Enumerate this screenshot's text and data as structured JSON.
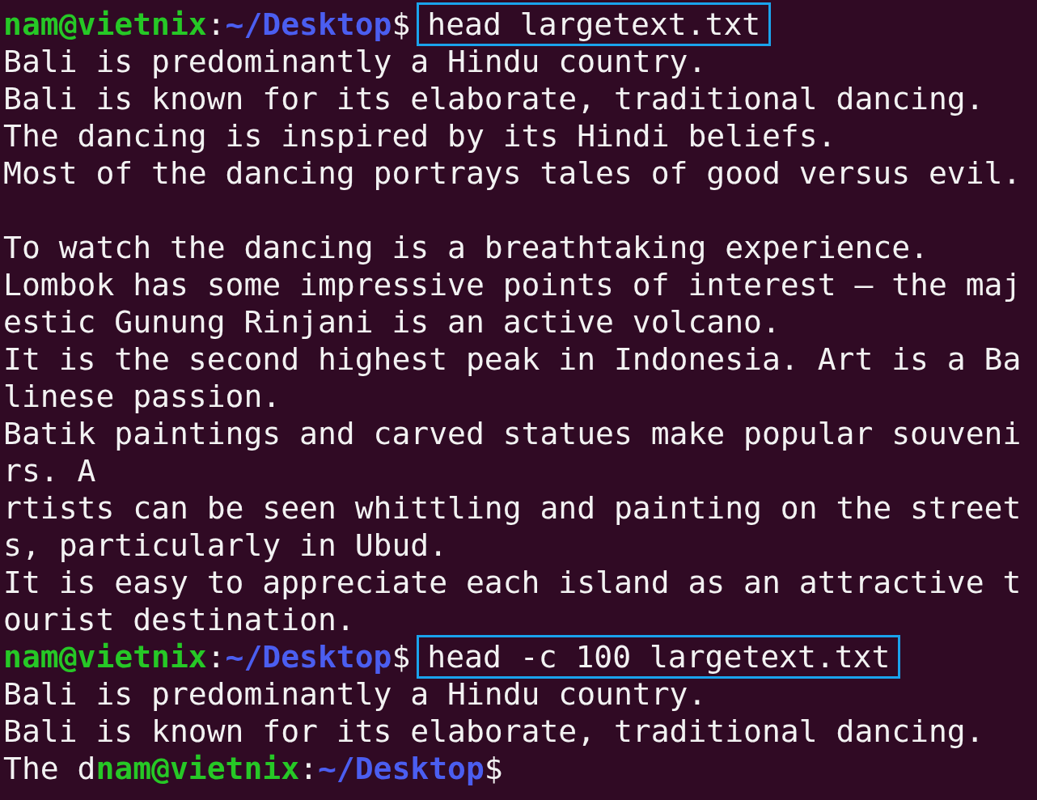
{
  "terminal": {
    "lines": [
      {
        "kind": "prompt",
        "user": "nam@vietnix",
        "separator": ":",
        "path": "~/Desktop",
        "symbol": "$",
        "command": "head largetext.txt",
        "highlighted": true
      },
      {
        "kind": "output",
        "text": "Bali is predominantly a Hindu country."
      },
      {
        "kind": "output",
        "text": "Bali is known for its elaborate, traditional dancing."
      },
      {
        "kind": "output",
        "text": "The dancing is inspired by its Hindi beliefs."
      },
      {
        "kind": "output",
        "text": "Most of the dancing portrays tales of good versus evil."
      },
      {
        "kind": "blank"
      },
      {
        "kind": "output",
        "text": "To watch the dancing is a breathtaking experience."
      },
      {
        "kind": "output",
        "text": "Lombok has some impressive points of interest – the maj"
      },
      {
        "kind": "output",
        "text": "estic Gunung Rinjani is an active volcano."
      },
      {
        "kind": "output",
        "text": "It is the second highest peak in Indonesia. Art is a Ba"
      },
      {
        "kind": "output",
        "text": "linese passion."
      },
      {
        "kind": "output",
        "text": "Batik paintings and carved statues make popular souveni"
      },
      {
        "kind": "output",
        "text": "rs. A"
      },
      {
        "kind": "output",
        "text": "rtists can be seen whittling and painting on the street"
      },
      {
        "kind": "output",
        "text": "s, particularly in Ubud."
      },
      {
        "kind": "output",
        "text": "It is easy to appreciate each island as an attractive t"
      },
      {
        "kind": "output",
        "text": "ourist destination."
      },
      {
        "kind": "prompt",
        "user": "nam@vietnix",
        "separator": ":",
        "path": "~/Desktop",
        "symbol": "$",
        "command": "head -c 100 largetext.txt",
        "highlighted": true
      },
      {
        "kind": "output",
        "text": "Bali is predominantly a Hindu country."
      },
      {
        "kind": "output",
        "text": "Bali is known for its elaborate, traditional dancing."
      },
      {
        "kind": "prompt",
        "prefix": "The d",
        "user": "nam@vietnix",
        "separator": ":",
        "path": "~/Desktop",
        "symbol": "$"
      }
    ]
  }
}
